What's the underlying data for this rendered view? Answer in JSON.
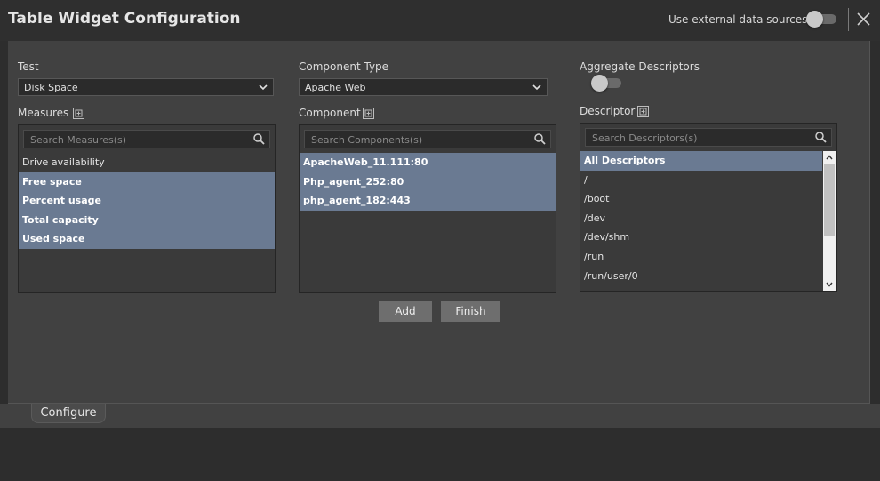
{
  "header": {
    "title": "Table Widget Configuration",
    "external_label": "Use external data sources"
  },
  "test": {
    "label": "Test",
    "value": "Disk Space"
  },
  "component_type": {
    "label": "Component Type",
    "value": "Apache Web"
  },
  "aggregate": {
    "label": "Aggregate Descriptors"
  },
  "measures": {
    "label": "Measures",
    "placeholder": "Search Measures(s)",
    "items": [
      {
        "label": "Drive availability",
        "selected": false
      },
      {
        "label": "Free space",
        "selected": true
      },
      {
        "label": "Percent usage",
        "selected": true
      },
      {
        "label": "Total capacity",
        "selected": true
      },
      {
        "label": "Used space",
        "selected": true
      }
    ]
  },
  "components": {
    "label": "Component",
    "placeholder": "Search Components(s)",
    "items": [
      {
        "label": "ApacheWeb_11.111:80",
        "selected": true
      },
      {
        "label": "Php_agent_252:80",
        "selected": true
      },
      {
        "label": "php_agent_182:443",
        "selected": true
      }
    ]
  },
  "descriptors": {
    "label": "Descriptor",
    "placeholder": "Search Descriptors(s)",
    "items": [
      {
        "label": "All Descriptors",
        "selected": true
      },
      {
        "label": "/",
        "selected": false
      },
      {
        "label": "/boot",
        "selected": false
      },
      {
        "label": "/dev",
        "selected": false
      },
      {
        "label": "/dev/shm",
        "selected": false
      },
      {
        "label": "/run",
        "selected": false
      },
      {
        "label": "/run/user/0",
        "selected": false
      }
    ]
  },
  "buttons": {
    "add": "Add",
    "finish": "Finish"
  },
  "tabs": {
    "configure": "Configure"
  },
  "colors": {
    "selected_row": "#6a7a92",
    "panel": "#414141",
    "header": "#2f2f2f"
  }
}
